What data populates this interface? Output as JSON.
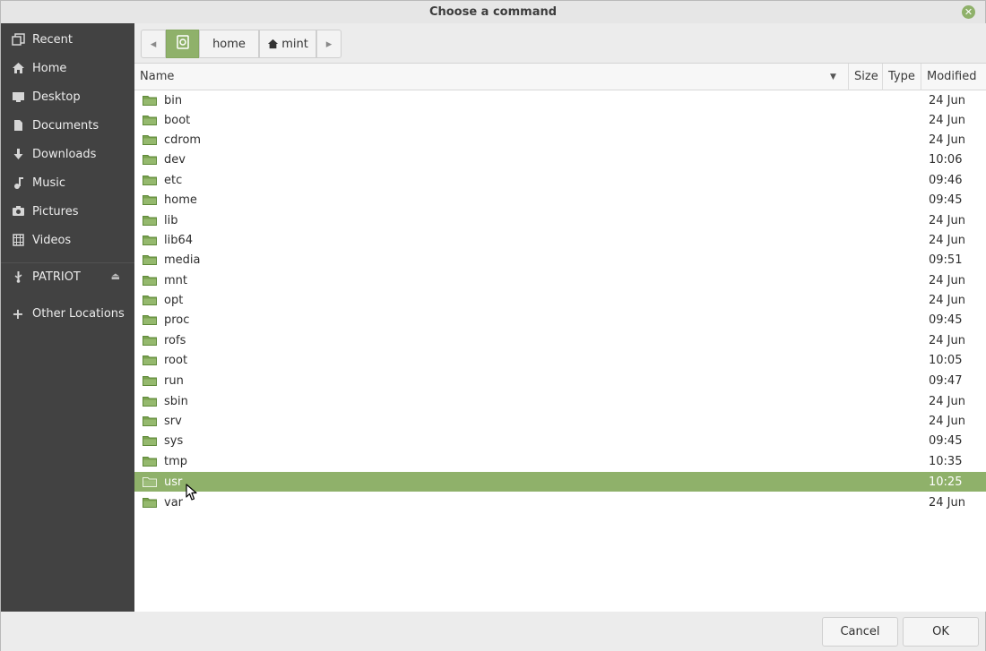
{
  "window": {
    "title": "Choose a command"
  },
  "sidebar": {
    "items": [
      {
        "label": "Recent",
        "icon": "recent-icon"
      },
      {
        "label": "Home",
        "icon": "home-icon"
      },
      {
        "label": "Desktop",
        "icon": "desktop-icon"
      },
      {
        "label": "Documents",
        "icon": "documents-icon"
      },
      {
        "label": "Downloads",
        "icon": "downloads-icon"
      },
      {
        "label": "Music",
        "icon": "music-icon"
      },
      {
        "label": "Pictures",
        "icon": "pictures-icon"
      },
      {
        "label": "Videos",
        "icon": "videos-icon"
      },
      {
        "label": "PATRIOT",
        "icon": "usb-icon"
      },
      {
        "label": "Other Locations",
        "icon": "plus-icon"
      }
    ]
  },
  "pathbar": {
    "segments": [
      {
        "label": "home"
      },
      {
        "label": "mint"
      }
    ]
  },
  "columns": {
    "name": "Name",
    "size": "Size",
    "type": "Type",
    "modified": "Modified"
  },
  "files": [
    {
      "name": "bin",
      "modified": "24 Jun"
    },
    {
      "name": "boot",
      "modified": "24 Jun"
    },
    {
      "name": "cdrom",
      "modified": "24 Jun"
    },
    {
      "name": "dev",
      "modified": "10:06"
    },
    {
      "name": "etc",
      "modified": "09:46"
    },
    {
      "name": "home",
      "modified": "09:45"
    },
    {
      "name": "lib",
      "modified": "24 Jun"
    },
    {
      "name": "lib64",
      "modified": "24 Jun"
    },
    {
      "name": "media",
      "modified": "09:51"
    },
    {
      "name": "mnt",
      "modified": "24 Jun"
    },
    {
      "name": "opt",
      "modified": "24 Jun"
    },
    {
      "name": "proc",
      "modified": "09:45"
    },
    {
      "name": "rofs",
      "modified": "24 Jun"
    },
    {
      "name": "root",
      "modified": "10:05"
    },
    {
      "name": "run",
      "modified": "09:47"
    },
    {
      "name": "sbin",
      "modified": "24 Jun"
    },
    {
      "name": "srv",
      "modified": "24 Jun"
    },
    {
      "name": "sys",
      "modified": "09:45"
    },
    {
      "name": "tmp",
      "modified": "10:35"
    },
    {
      "name": "usr",
      "modified": "10:25",
      "selected": true
    },
    {
      "name": "var",
      "modified": "24 Jun"
    }
  ],
  "buttons": {
    "cancel": "Cancel",
    "ok": "OK"
  },
  "colors": {
    "accent": "#8fb16a",
    "sidebar_bg": "#424242"
  }
}
